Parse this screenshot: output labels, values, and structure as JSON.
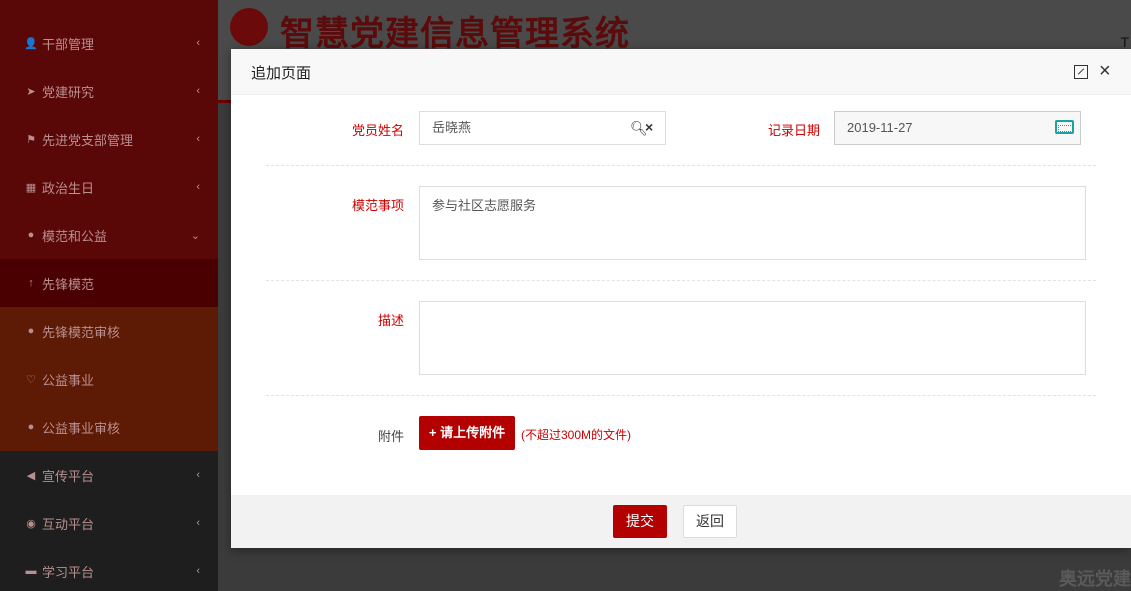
{
  "app": {
    "title": "智慧党建信息管理系统",
    "topright_text": "T",
    "watermark": "奥远党建"
  },
  "sidebar": {
    "items": [
      {
        "label": "干部管理",
        "icon": "user-icon"
      },
      {
        "label": "党建研究",
        "icon": "rocket-icon"
      },
      {
        "label": "先进党支部管理",
        "icon": "flag-icon"
      },
      {
        "label": "政治生日",
        "icon": "cake-icon"
      },
      {
        "label": "模范和公益",
        "icon": "check-circle-icon"
      },
      {
        "label": "先锋模范",
        "icon": "arrow-up-icon"
      },
      {
        "label": "先锋模范审核",
        "icon": "check-circle-icon"
      },
      {
        "label": "公益事业",
        "icon": "heart-icon"
      },
      {
        "label": "公益事业审核",
        "icon": "check-circle-icon"
      },
      {
        "label": "宣传平台",
        "icon": "bullhorn-icon"
      },
      {
        "label": "互动平台",
        "icon": "chat-icon"
      },
      {
        "label": "学习平台",
        "icon": "book-icon"
      }
    ]
  },
  "modal": {
    "title": "追加页面",
    "form": {
      "member_name_label": "党员姓名",
      "member_name_value": "岳晓燕",
      "date_label": "记录日期",
      "date_value": "2019-11-27",
      "deeds_label": "模范事项",
      "deeds_value": "参与社区志愿服务",
      "desc_label": "描述",
      "desc_value": "",
      "attach_label": "附件",
      "upload_label": "+ 请上传附件",
      "upload_hint": "(不超过300M的文件)"
    },
    "footer": {
      "submit_label": "提交",
      "back_label": "返回"
    }
  },
  "colors": {
    "primary": "#b30000",
    "label_red": "#cc0000",
    "calendar_icon": "#1aa1a1"
  }
}
